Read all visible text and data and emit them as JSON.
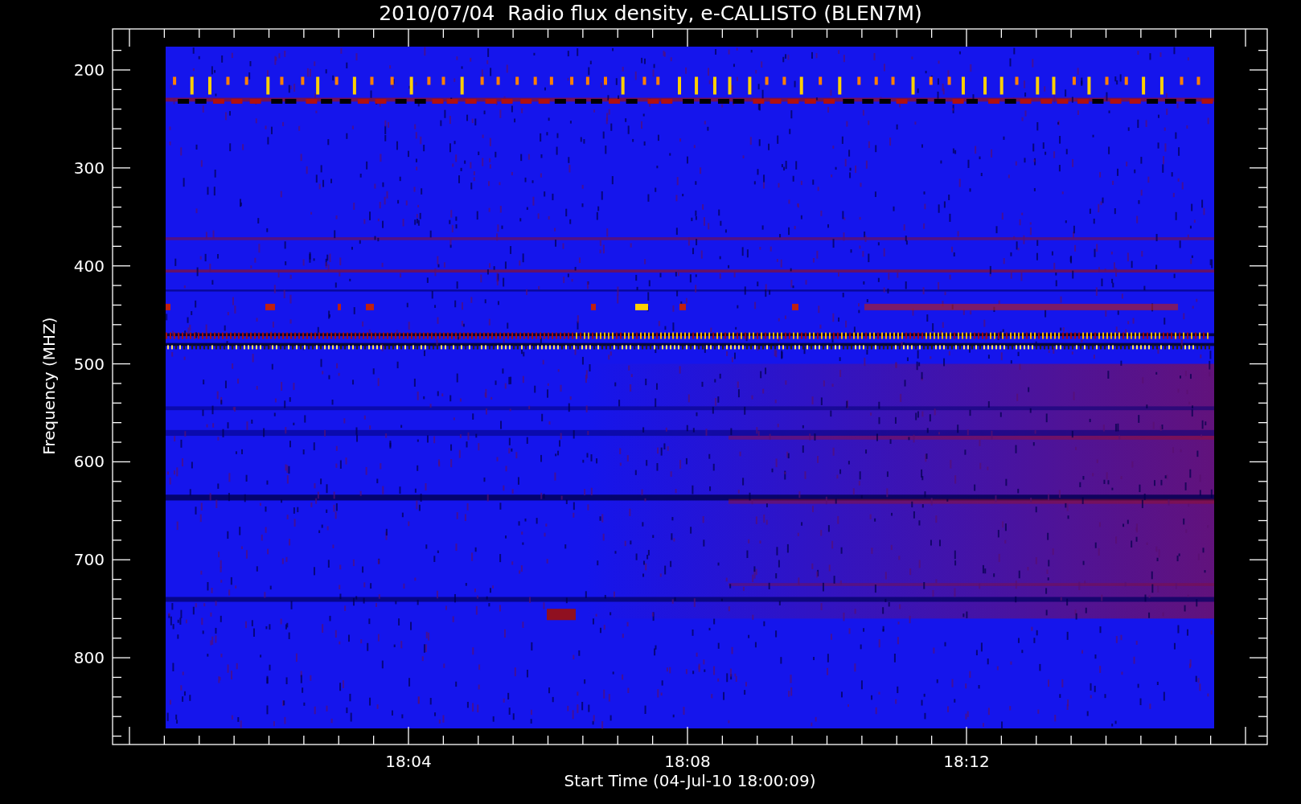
{
  "title": "2010/07/04  Radio flux density, e-CALLISTO (BLEN7M)",
  "plot": {
    "ylabel": "Frequency (MHZ)",
    "yticks": [
      "200",
      "300",
      "400",
      "500",
      "600",
      "700",
      "800"
    ],
    "xticks": [
      "18:04",
      "18:08",
      "18:12"
    ],
    "xlabel": "Start Time (04-Jul-10 18:00:09)"
  }
}
